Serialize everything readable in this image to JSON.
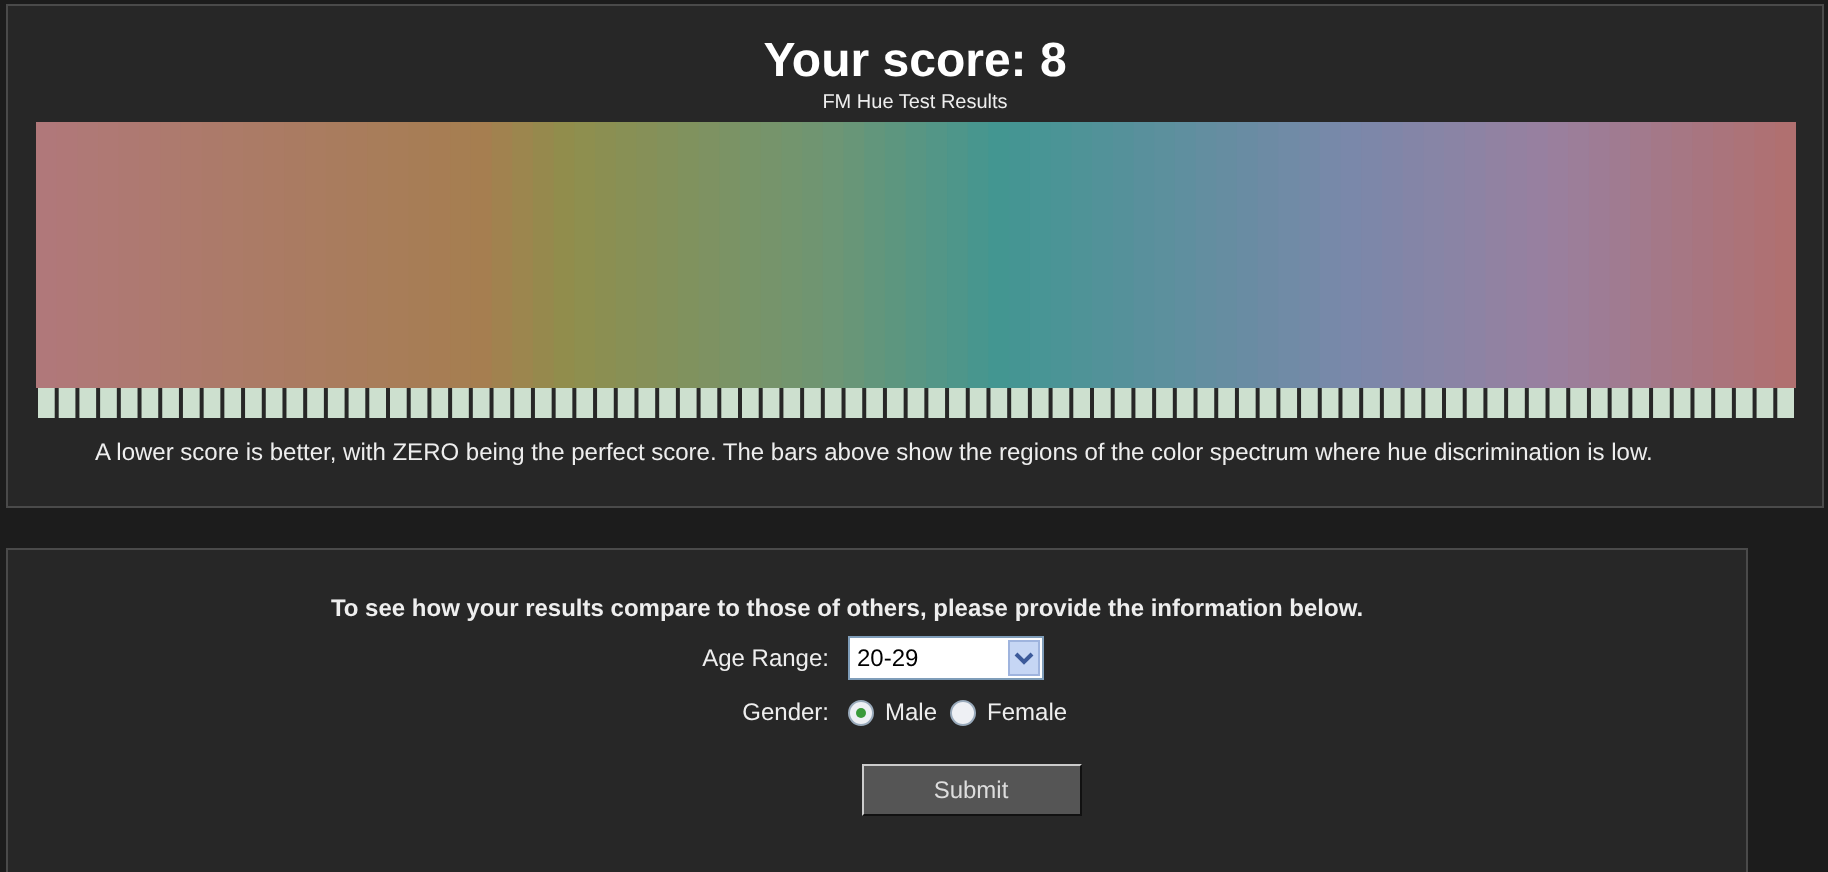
{
  "results": {
    "title": "Your score: 8",
    "subtitle": "FM Hue Test Results",
    "note": "A lower score is better, with ZERO being the perfect score. The bars above show the regions of the color spectrum where hue discrimination is low."
  },
  "form": {
    "intro": "To see how your results compare to those of others, please provide the information below.",
    "age": {
      "label": "Age Range:",
      "value": "20-29"
    },
    "gender": {
      "label": "Gender:",
      "options": [
        {
          "label": "Male",
          "selected": true
        },
        {
          "label": "Female",
          "selected": false
        }
      ]
    },
    "submit": "Submit"
  }
}
